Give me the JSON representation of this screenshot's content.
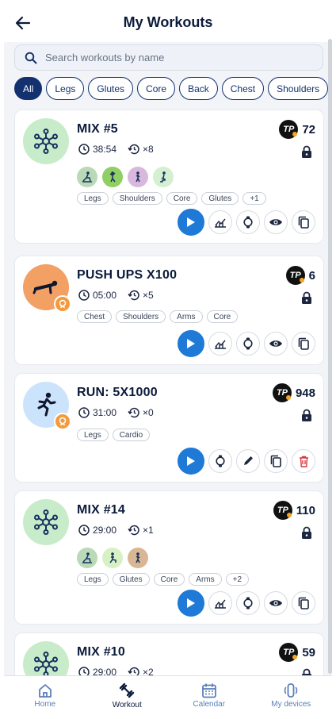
{
  "header": {
    "title": "My Workouts"
  },
  "search": {
    "placeholder": "Search workouts by name"
  },
  "filters": [
    "All",
    "Legs",
    "Glutes",
    "Core",
    "Back",
    "Chest",
    "Shoulders"
  ],
  "workouts": [
    {
      "name": "MIX #5",
      "duration": "38:54",
      "count": "×8",
      "tp": "72",
      "tags": [
        "Legs",
        "Shoulders",
        "Core",
        "Glutes",
        "+1"
      ]
    },
    {
      "name": "PUSH UPS X100",
      "duration": "05:00",
      "count": "×5",
      "tp": "6",
      "tags": [
        "Chest",
        "Shoulders",
        "Arms",
        "Core"
      ]
    },
    {
      "name": "RUN: 5X1000",
      "duration": "31:00",
      "count": "×0",
      "tp": "948",
      "tags": [
        "Legs",
        "Cardio"
      ]
    },
    {
      "name": "MIX #14",
      "duration": "29:00",
      "count": "×1",
      "tp": "110",
      "tags": [
        "Legs",
        "Glutes",
        "Core",
        "Arms",
        "+2"
      ]
    },
    {
      "name": "MIX #10",
      "duration": "29:00",
      "count": "×2",
      "tp": "59",
      "tags": []
    }
  ],
  "tp_logo_text": "TP",
  "nav": {
    "home": "Home",
    "workout": "Workout",
    "calendar": "Calendar",
    "devices": "My devices"
  },
  "colors": {
    "primary": "#13316e",
    "play": "#1e7ad6",
    "mix_bg": "#c8ecc9",
    "push_bg": "#f3a064",
    "run_bg": "#cce4fb",
    "badge": "#f39a3c",
    "delete": "#d6383e"
  }
}
